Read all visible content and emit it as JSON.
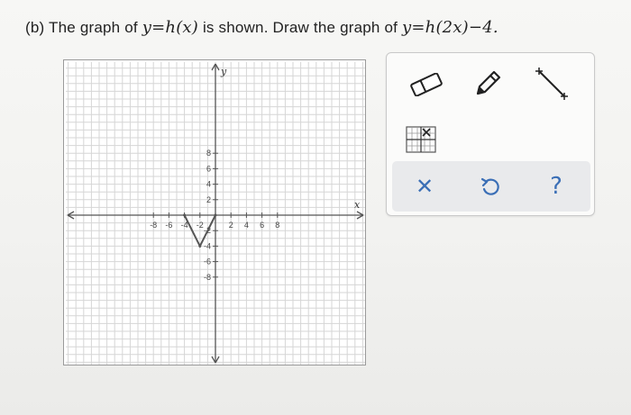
{
  "question": {
    "part": "(b)",
    "text_before": "The graph of",
    "f1": "y=h(x)",
    "text_middle": "is shown. Draw the graph of",
    "f2": "y=h(2x)−4."
  },
  "graph": {
    "x_label": "x",
    "y_label": "y",
    "x_tick_labels": [
      "-8",
      "-6",
      "-4",
      "-2",
      "2",
      "4",
      "6",
      "8"
    ],
    "y_tick_labels": [
      "8",
      "6",
      "4",
      "2",
      "-2",
      "-4",
      "-6",
      "-8"
    ],
    "curve": {
      "points": [
        [
          -4,
          0
        ],
        [
          -2,
          -4
        ],
        [
          0,
          0
        ]
      ],
      "color": "#555555"
    }
  },
  "tools": {
    "eraser": "eraser-icon",
    "pencil": "pencil-icon",
    "line": "line-segment-icon",
    "grid": "grid-x-icon",
    "accent_color": "#3b6fb6"
  },
  "actions": {
    "clear": "✕",
    "undo": "undo-icon",
    "help": "?"
  }
}
